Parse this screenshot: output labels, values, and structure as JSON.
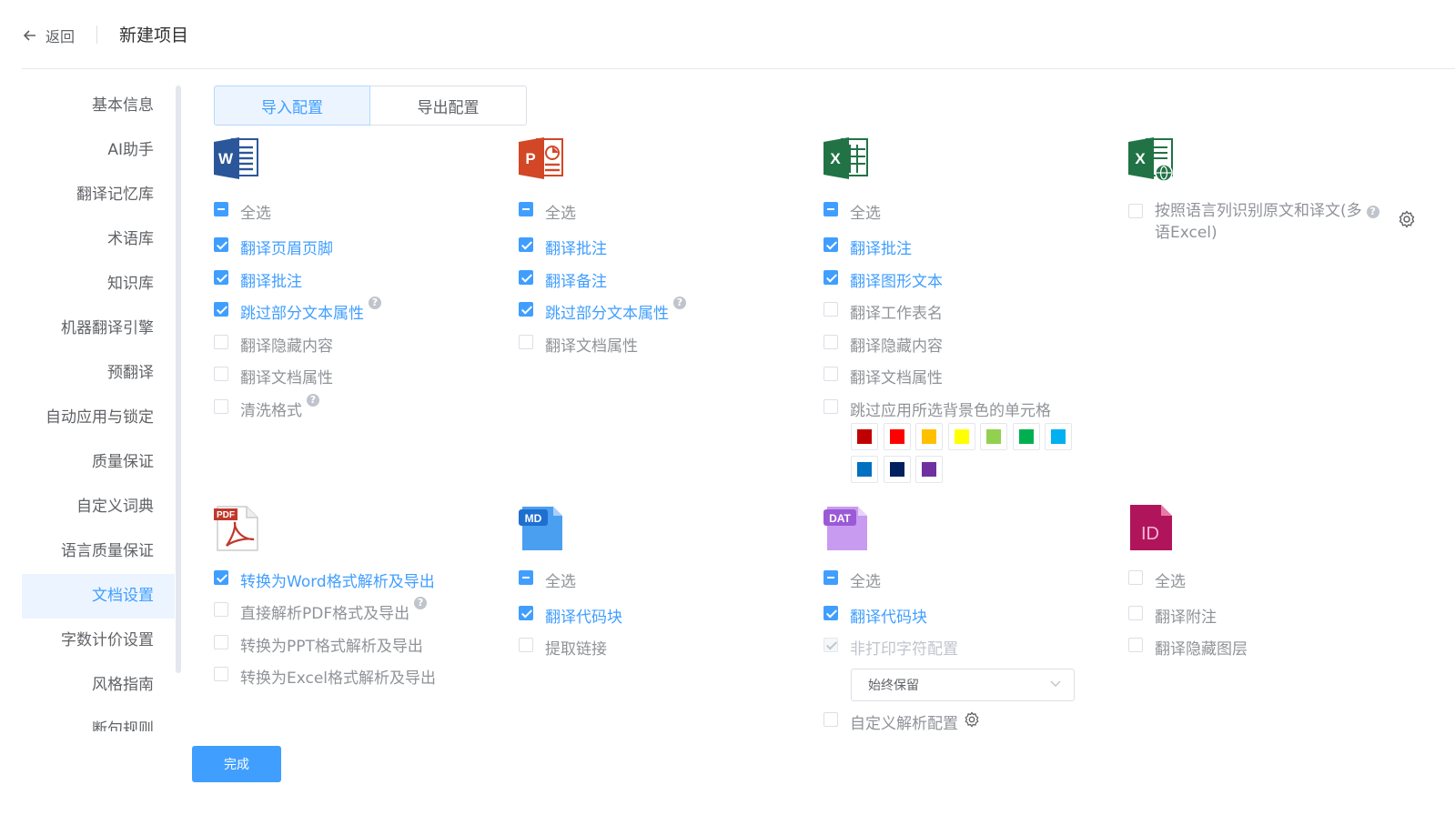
{
  "header": {
    "back_label": "返回",
    "title": "新建项目"
  },
  "sidebar": {
    "items": [
      {
        "label": "基本信息"
      },
      {
        "label": "AI助手"
      },
      {
        "label": "翻译记忆库"
      },
      {
        "label": "术语库"
      },
      {
        "label": "知识库"
      },
      {
        "label": "机器翻译引擎"
      },
      {
        "label": "预翻译"
      },
      {
        "label": "自动应用与锁定"
      },
      {
        "label": "质量保证"
      },
      {
        "label": "自定义词典"
      },
      {
        "label": "语言质量保证"
      },
      {
        "label": "文档设置",
        "active": true
      },
      {
        "label": "字数计价设置"
      },
      {
        "label": "风格指南"
      },
      {
        "label": "断句规则"
      }
    ]
  },
  "tabs": {
    "import": "导入配置",
    "export": "导出配置"
  },
  "word": {
    "icon_letter": "W",
    "select_all": "全选",
    "options": [
      "翻译页眉页脚",
      "翻译批注",
      "跳过部分文本属性",
      "翻译隐藏内容",
      "翻译文档属性",
      "清洗格式"
    ]
  },
  "ppt": {
    "icon_letter": "P",
    "select_all": "全选",
    "options": [
      "翻译批注",
      "翻译备注",
      "跳过部分文本属性",
      "翻译文档属性"
    ]
  },
  "excel": {
    "icon_letter": "X",
    "select_all": "全选",
    "options": [
      "翻译批注",
      "翻译图形文本",
      "翻译工作表名",
      "翻译隐藏内容",
      "翻译文档属性",
      "跳过应用所选背景色的单元格"
    ],
    "swatch_colors": [
      "#c00000",
      "#ff0000",
      "#ffc000",
      "#ffff00",
      "#92d050",
      "#00b050",
      "#00b0f0",
      "#0070c0",
      "#002060",
      "#7030a0"
    ]
  },
  "multilang_excel": {
    "icon_letter": "X",
    "option_line1": "按照语言列识别原文和译文(多",
    "option_line2": "语Excel)"
  },
  "pdf": {
    "icon_label": "PDF",
    "options": [
      "转换为Word格式解析及导出",
      "直接解析PDF格式及导出",
      "转换为PPT格式解析及导出",
      "转换为Excel格式解析及导出"
    ]
  },
  "md": {
    "icon_label": "MD",
    "select_all": "全选",
    "options": [
      "翻译代码块",
      "提取链接"
    ]
  },
  "dat": {
    "icon_label": "DAT",
    "select_all": "全选",
    "options": [
      "翻译代码块",
      "非打印字符配置"
    ],
    "select_value": "始终保留",
    "custom_config": "自定义解析配置"
  },
  "indesign": {
    "icon_label": "ID",
    "select_all": "全选",
    "options": [
      "翻译附注",
      "翻译隐藏图层"
    ]
  },
  "help_glyph": "?",
  "done_label": "完成",
  "accent_color": "#409eff"
}
